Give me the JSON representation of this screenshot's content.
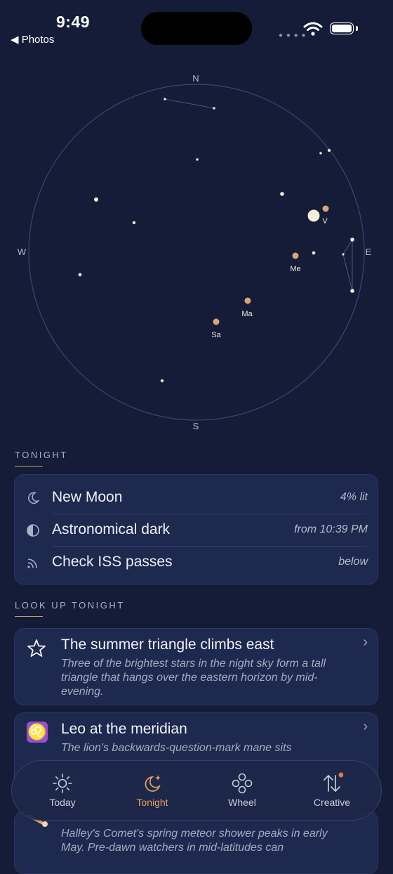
{
  "status_bar": {
    "time": "9:49",
    "back_label": "◀ Photos"
  },
  "sky_map": {
    "compass": {
      "north": "N",
      "south": "S",
      "east": "E",
      "west": "W"
    },
    "planet_labels": {
      "venus": "V",
      "mercury": "Me",
      "mars": "Ma",
      "saturn": "Sa"
    }
  },
  "tonight": {
    "heading": "TONIGHT",
    "rows": [
      {
        "icon": "moon-icon",
        "title": "New Moon",
        "value": "4% lit"
      },
      {
        "icon": "half-circle-icon",
        "title": "Astronomical dark",
        "value": "from 10:39 PM"
      },
      {
        "icon": "broadcast-icon",
        "title": "Check ISS passes",
        "value": "below"
      }
    ]
  },
  "look_up": {
    "heading": "LOOK UP TONIGHT",
    "items": [
      {
        "icon": "star-outline-icon",
        "title": "The summer triangle climbs east",
        "description": "Three of the brightest stars in the night sky form a tall triangle that hangs over the eastern horizon by mid-evening."
      },
      {
        "icon": "leo-zodiac-icon",
        "title": "Leo at the meridian",
        "description": "The lion's backwards-question-mark mane sits"
      },
      {
        "icon": "comet-icon",
        "title": "",
        "description": "Halley's Comet's spring meteor shower peaks in early May. Pre-dawn watchers in mid-latitudes can"
      }
    ]
  },
  "tab_bar": {
    "tabs": [
      {
        "label": "Today",
        "icon": "sun-icon",
        "active": false
      },
      {
        "label": "Tonight",
        "icon": "moon-stars-icon",
        "active": true
      },
      {
        "label": "Wheel",
        "icon": "wheel-icon",
        "active": false
      },
      {
        "label": "Creative",
        "icon": "arrows-up-down-icon",
        "active": false
      }
    ]
  },
  "colors": {
    "background": "#141c37",
    "card": "#1e2950",
    "accent": "#e6a25e",
    "planet": "#d9a475"
  }
}
